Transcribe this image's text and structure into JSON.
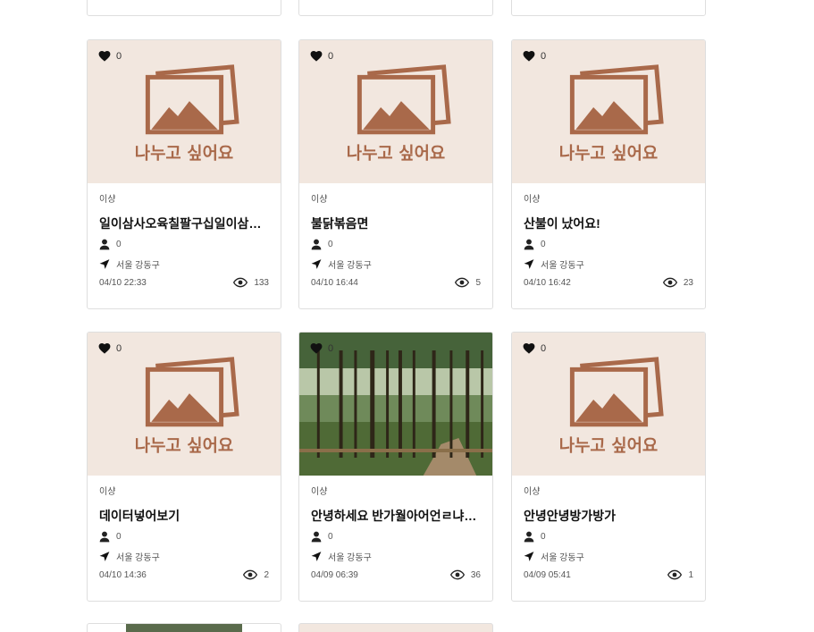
{
  "colors": {
    "placeholder_bg": "#f2e7df",
    "placeholder_brown": "#a9694a"
  },
  "placeholder_text": "나누고 싶어요",
  "cards": [
    {
      "likes": "0",
      "category": "이샹",
      "title": "일이삼사오육칠팔구십일이삼사오육칠팔구십",
      "author_count": "0",
      "location": "서울 강동구",
      "date": "04/10 22:33",
      "views": "133",
      "image": "placeholder"
    },
    {
      "likes": "0",
      "category": "이샹",
      "title": "불닭볶음면",
      "author_count": "0",
      "location": "서울 강동구",
      "date": "04/10 16:44",
      "views": "5",
      "image": "placeholder"
    },
    {
      "likes": "0",
      "category": "이샹",
      "title": "산불이 났어요!",
      "author_count": "0",
      "location": "서울 강동구",
      "date": "04/10 16:42",
      "views": "23",
      "image": "placeholder"
    },
    {
      "likes": "0",
      "category": "이샹",
      "title": "데이터넣어보기",
      "author_count": "0",
      "location": "서울 강동구",
      "date": "04/10 14:36",
      "views": "2",
      "image": "placeholder"
    },
    {
      "likes": "0",
      "category": "이샹",
      "title": "안녕하세요 반가월아어언ㄹ냐어ㅏ",
      "author_count": "0",
      "location": "서울 강동구",
      "date": "04/09 06:39",
      "views": "36",
      "image": "photo-forest"
    },
    {
      "likes": "0",
      "category": "이샹",
      "title": "안녕안녕방가방가",
      "author_count": "0",
      "location": "서울 강동구",
      "date": "04/09 05:41",
      "views": "1",
      "image": "placeholder"
    }
  ],
  "icons": {
    "like": "heart-icon",
    "author": "person-icon",
    "location": "location-arrow-icon",
    "views": "eye-icon",
    "placeholder": "image-gallery-icon"
  }
}
